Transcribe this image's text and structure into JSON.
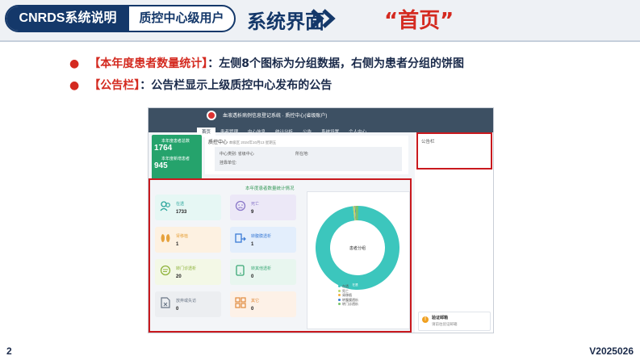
{
  "header": {
    "doc_badge": "CNRDS系统说明",
    "role_badge": "质控中心级用户",
    "section_title": "系统界面",
    "page_title": "“首页”"
  },
  "bullets": [
    {
      "highlight": "【本年度患者数量统计】",
      "text": "：左侧8个图标为分组数据，右侧为患者分组的饼图"
    },
    {
      "highlight": "【公告栏】",
      "text": "：公告栏显示上级质控中心发布的公告"
    }
  ],
  "footer": {
    "page_number": "2",
    "version": "V2025026"
  },
  "screenshot": {
    "app_name": "血液透析病例信息登记系统 · 质控中心(省级账户)",
    "nav": [
      "首页",
      "患者管理",
      "中心信息",
      "统计分析",
      "公告",
      "系统设置",
      "个人中心"
    ],
    "side_stats": [
      {
        "label": "本年度患者总数",
        "value": "1764"
      },
      {
        "label": "本年度新增患者",
        "value": "945"
      }
    ],
    "hospital_label": "质控中心",
    "hospital_meta": "本级区 2024年10月13 星期五",
    "info_rows": [
      "中心类别: 省级中心",
      "所在地:",
      "挂靠单位:"
    ],
    "section_title": "本年度患者数量统计情况",
    "cards": [
      {
        "label": "在透",
        "value": "1733",
        "icon": "users-icon",
        "bg": "#e6f7f4",
        "fg": "#28a59b"
      },
      {
        "label": "死亡",
        "value": "9",
        "icon": "sad-face-icon",
        "bg": "#ece8f7",
        "fg": "#8a78c9"
      },
      {
        "label": "肾移植",
        "value": "1",
        "icon": "kidney-icon",
        "bg": "#fdf1e1",
        "fg": "#e6a23c"
      },
      {
        "label": "转腹膜透析",
        "value": "1",
        "icon": "transfer-icon",
        "bg": "#e3eefc",
        "fg": "#3a7bd5"
      },
      {
        "label": "转门诊透析",
        "value": "20",
        "icon": "chat-icon",
        "bg": "#f3f8e6",
        "fg": "#8fb33b"
      },
      {
        "label": "转其他透析",
        "value": "0",
        "icon": "phone-icon",
        "bg": "#e8f6ef",
        "fg": "#3aa876"
      },
      {
        "label": "放弃或失访",
        "value": "0",
        "icon": "file-x-icon",
        "bg": "#eceef1",
        "fg": "#6a7686"
      },
      {
        "label": "其它",
        "value": "0",
        "icon": "grid-icon",
        "bg": "#fdf1e7",
        "fg": "#e08a3c"
      }
    ],
    "pie": {
      "center_label": "患者分组",
      "segments": [
        {
          "name": "在透",
          "value": 1733,
          "color": "#3cc6bd"
        },
        {
          "name": "死亡",
          "value": 9,
          "color": "#b7d76e"
        },
        {
          "name": "肾移植",
          "value": 1,
          "color": "#f5b03c"
        },
        {
          "name": "转腹膜透析",
          "value": 1,
          "color": "#3a7bd5"
        },
        {
          "name": "转门诊透析",
          "value": 20,
          "color": "#7bc46a"
        }
      ],
      "slice_label": "在透"
    },
    "notice_label": "公告栏",
    "verify": {
      "title": "验证邮箱",
      "text": "请前往验证邮箱"
    }
  }
}
